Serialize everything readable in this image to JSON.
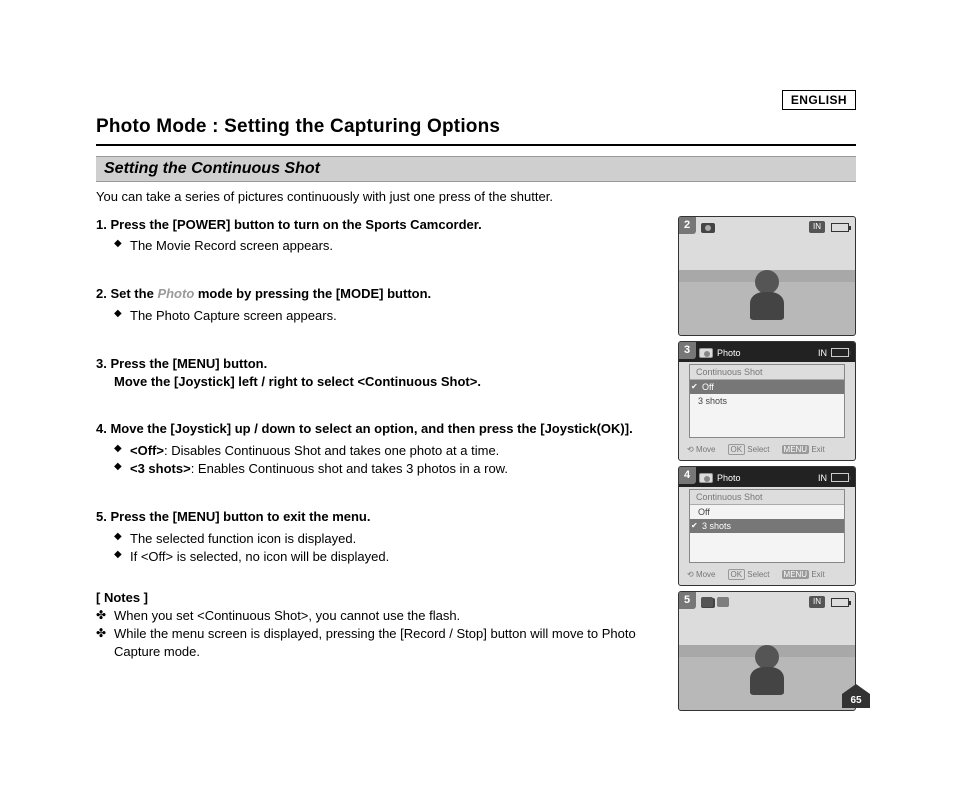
{
  "language": "ENGLISH",
  "page_title": "Photo Mode : Setting the Capturing Options",
  "section_heading": "Setting the Continuous Shot",
  "intro": "You can take a series of pictures continuously with just one press of the shutter.",
  "steps": {
    "s1": {
      "head": "Press the [POWER] button to turn on the Sports Camcorder.",
      "b1": "The Movie Record screen appears."
    },
    "s2": {
      "head_pre": "Set the ",
      "head_mode": "Photo",
      "head_post": " mode by pressing the [MODE] button.",
      "b1": "The Photo Capture screen appears."
    },
    "s3": {
      "head": "Press the [MENU] button.",
      "head2": "Move the [Joystick] left / right to select <Continuous Shot>."
    },
    "s4": {
      "head": "Move the [Joystick] up / down to select an option, and then press the [Joystick(OK)].",
      "b1_opt": "<Off>",
      "b1_txt": ": Disables Continuous Shot and takes one photo at a time.",
      "b2_opt": "<3 shots>",
      "b2_txt": ": Enables Continuous shot and takes 3 photos in a row."
    },
    "s5": {
      "head": "Press the [MENU] button to exit the menu.",
      "b1": "The selected function icon is displayed.",
      "b2": "If <Off> is selected, no icon will be displayed."
    }
  },
  "notes": {
    "head": "[ Notes ]",
    "n1": "When you set <Continuous Shot>, you cannot use the flash.",
    "n2": "While the menu screen is displayed, pressing the [Record / Stop] button will move to Photo Capture mode."
  },
  "figs": {
    "f2": {
      "num": "2",
      "in": "IN"
    },
    "f3": {
      "num": "3",
      "mode": "Photo",
      "menu_title": "Continuous Shot",
      "opt1": "Off",
      "opt2": "3 shots",
      "move": "Move",
      "select": "Select",
      "exit": "Exit",
      "ok": "OK",
      "menu": "MENU",
      "in": "IN"
    },
    "f4": {
      "num": "4",
      "mode": "Photo",
      "menu_title": "Continuous Shot",
      "opt1": "Off",
      "opt2": "3 shots",
      "move": "Move",
      "select": "Select",
      "exit": "Exit",
      "ok": "OK",
      "menu": "MENU",
      "in": "IN"
    },
    "f5": {
      "num": "5",
      "in": "IN"
    }
  },
  "page_number": "65"
}
